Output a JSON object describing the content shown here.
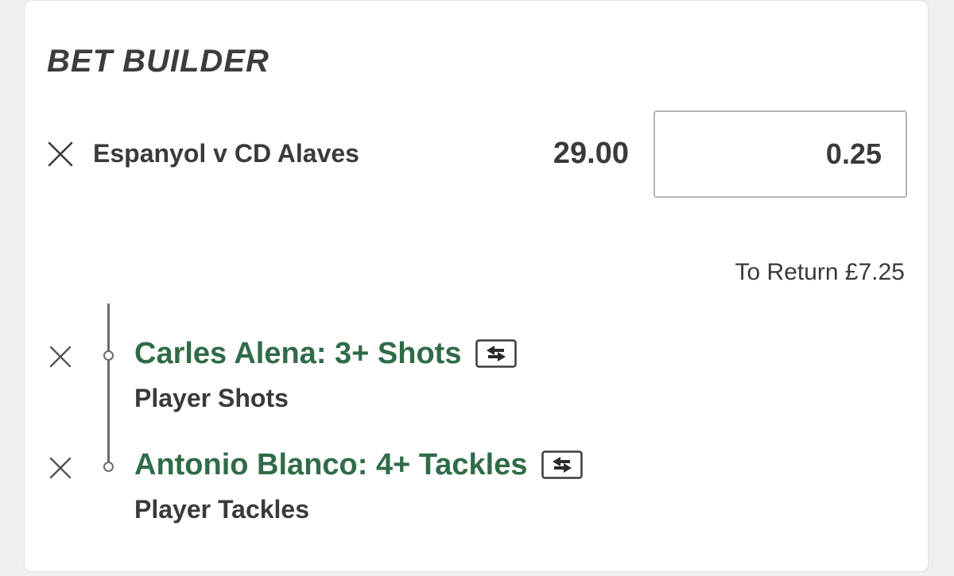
{
  "card": {
    "title": "BET BUILDER"
  },
  "match": {
    "name": "Espanyol v CD Alaves",
    "odds": "29.00",
    "stake": "0.25",
    "to_return": "To Return £7.25"
  },
  "selections": [
    {
      "title": "Carles Alena: 3+ Shots",
      "market": "Player Shots"
    },
    {
      "title": "Antonio Blanco: 4+ Tackles",
      "market": "Player Tackles"
    }
  ],
  "colors": {
    "selection_green": "#2f6b47",
    "text_dark": "#3a3a3a",
    "page_bg": "#efefef"
  },
  "icons": {
    "remove": "close-icon",
    "swap": "swap-arrows-icon"
  }
}
